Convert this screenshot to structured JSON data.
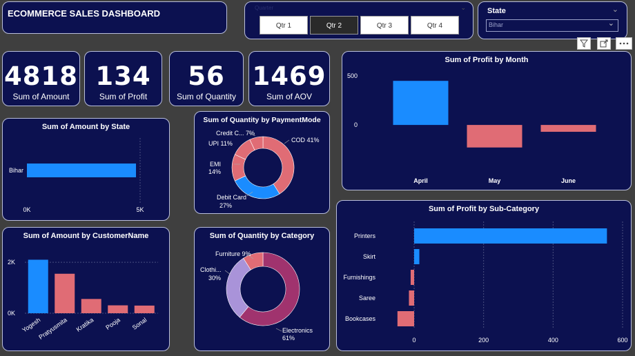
{
  "header": {
    "title": "ECOMMERCE SALES DASHBOARD"
  },
  "quarter_slicer": {
    "title": "Quarter",
    "options": [
      "Qtr 1",
      "Qtr 2",
      "Qtr 3",
      "Qtr 4"
    ],
    "selected": "Qtr 2"
  },
  "state_slicer": {
    "title": "State",
    "value": "Bihar"
  },
  "kpis": [
    {
      "value": "4818",
      "label": "Sum of Amount"
    },
    {
      "value": "134",
      "label": "Sum of Profit"
    },
    {
      "value": "56",
      "label": "Sum of Quantity"
    },
    {
      "value": "1469",
      "label": "Sum of AOV"
    }
  ],
  "colors": {
    "background": "#3f3f3f",
    "card": "#0c1150",
    "positive": "#1a8cff",
    "negative": "#e06c75",
    "category_purple": "#a0336e",
    "category_lavender": "#a993d9"
  },
  "chart_data": [
    {
      "id": "profit_by_month",
      "type": "bar",
      "title": "Sum of Profit by Month",
      "categories": [
        "April",
        "May",
        "June"
      ],
      "values": [
        450,
        -230,
        -70
      ],
      "ylim": [
        -450,
        550
      ],
      "yticks": [
        "500",
        "0"
      ],
      "tick_values": [
        500,
        0
      ],
      "grid": false
    },
    {
      "id": "amount_by_state",
      "type": "bar",
      "orientation": "horizontal",
      "title": "Sum of Amount by State",
      "categories": [
        "Bihar"
      ],
      "values": [
        4818
      ],
      "xlim": [
        0,
        5000
      ],
      "xticks": [
        "0K",
        "5K"
      ],
      "tick_values": [
        0,
        5000
      ]
    },
    {
      "id": "quantity_by_payment",
      "type": "pie",
      "donut": true,
      "title": "Sum of Quantity by PaymentMode",
      "slices": [
        {
          "label": "COD",
          "pct_label": "41%",
          "value": 41
        },
        {
          "label": "Debit Card",
          "pct_label": "27%",
          "value": 27
        },
        {
          "label": "EMI",
          "pct_label": "14%",
          "value": 14
        },
        {
          "label": "UPI",
          "pct_label": "11%",
          "value": 11
        },
        {
          "label": "Credit C...",
          "pct_label": "7%",
          "value": 7
        }
      ]
    },
    {
      "id": "amount_by_customer",
      "type": "bar",
      "title": "Sum of Amount by CustomerName",
      "categories": [
        "Yogesh",
        "Pratyusmita",
        "Kratika",
        "Pooja",
        "Sonal"
      ],
      "values": [
        2100,
        1550,
        560,
        310,
        300
      ],
      "ylim": [
        0,
        2600
      ],
      "yticks": [
        "2K",
        "0K"
      ],
      "tick_values": [
        2000,
        0
      ]
    },
    {
      "id": "quantity_by_category",
      "type": "pie",
      "donut": true,
      "title": "Sum of Quantity by Category",
      "slices": [
        {
          "label": "Electronics",
          "pct_label": "61%",
          "value": 61
        },
        {
          "label": "Clothi...",
          "pct_label": "30%",
          "value": 30
        },
        {
          "label": "Furniture",
          "pct_label": "9%",
          "value": 9
        }
      ]
    },
    {
      "id": "profit_by_subcategory",
      "type": "bar",
      "orientation": "horizontal",
      "title": "Sum of Profit by Sub-Category",
      "categories": [
        "Printers",
        "Skirt",
        "Furnishings",
        "Saree",
        "Bookcases"
      ],
      "values": [
        555,
        15,
        -10,
        -15,
        -48
      ],
      "xlim": [
        -50,
        600
      ],
      "xticks": [
        "0",
        "200",
        "400",
        "600"
      ],
      "tick_values": [
        0,
        200,
        400,
        600
      ]
    }
  ]
}
